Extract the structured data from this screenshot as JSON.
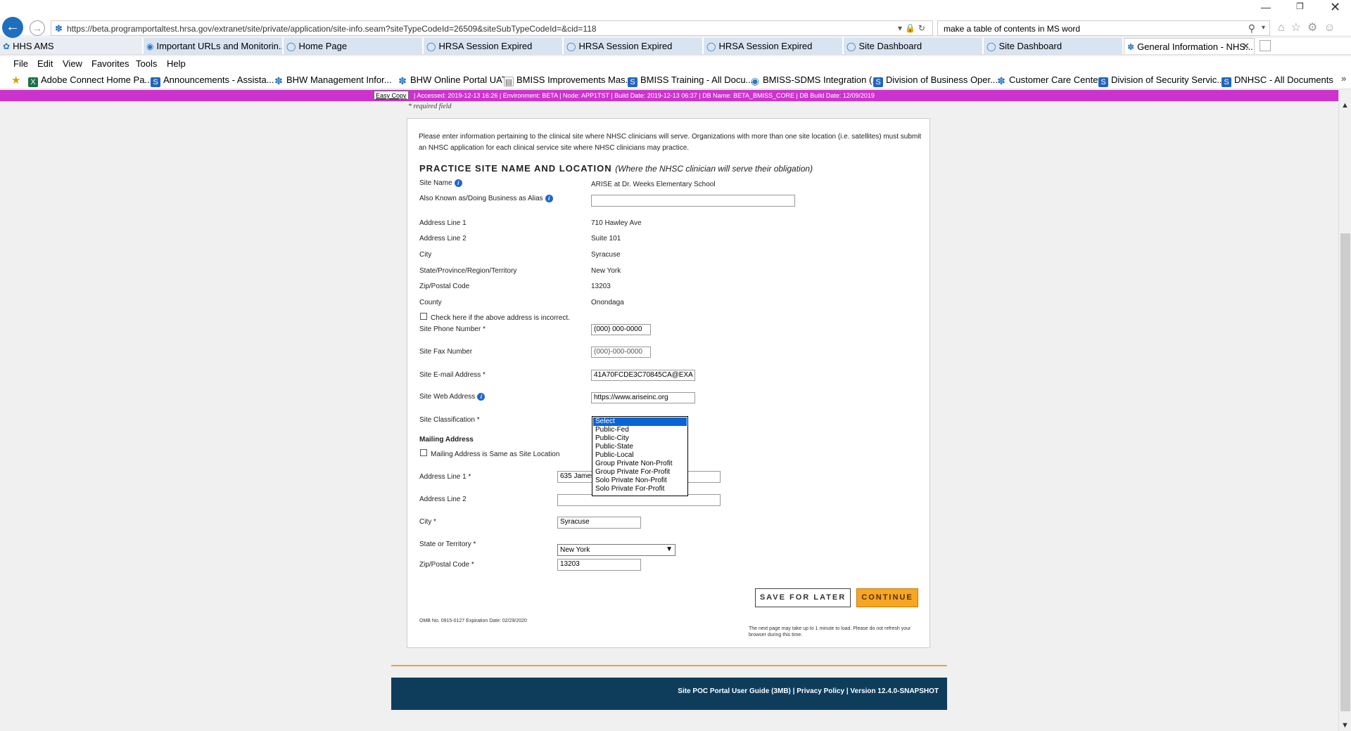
{
  "browser": {
    "url": "https://beta.programportaltest.hrsa.gov/extranet/site/private/application/site-info.seam?siteTypeCodeId=26509&siteSubTypeCodeId=&cid=118",
    "search": "make a table of contents in MS word",
    "tabs": [
      {
        "label": "HHS AMS"
      },
      {
        "label": "Important URLs and Monitorin..."
      },
      {
        "label": "Home Page"
      },
      {
        "label": "HRSA Session Expired"
      },
      {
        "label": "HRSA Session Expired"
      },
      {
        "label": "HRSA Session Expired"
      },
      {
        "label": "Site Dashboard"
      },
      {
        "label": "Site Dashboard"
      },
      {
        "label": "General Information - NHS..."
      }
    ],
    "menu": [
      "File",
      "Edit",
      "View",
      "Favorites",
      "Tools",
      "Help"
    ],
    "favorites": [
      "Adobe Connect Home Pa...",
      "Announcements - Assista...",
      "BHW Management Infor...",
      "BHW Online Portal UAT",
      "BMISS Improvements Mas...",
      "BMISS Training - All Docu...",
      "BMISS-SDMS Integration (...",
      "Division of Business Oper...",
      "Customer Care Center",
      "Division of Security Servic...",
      "DNHSC - All Documents"
    ]
  },
  "env_bar": {
    "easy_copy": "Easy Copy",
    "text": "|   Accessed: 2019-12-13 16:26   |   Environment: BETA   |   Node: APP1TST   |   Build Date: 2019-12-13 06:37   |   DB Name: BETA_BMISS_CORE   |   DB Build Date: 12/09/2019"
  },
  "form": {
    "required_note": "* required field",
    "intro": "Please enter information pertaining to the clinical site where NHSC clinicians will serve. Organizations with more than one site location (i.e. satellites) must submit an NHSC application for each clinical service site where NHSC clinicians may practice.",
    "section_title": "PRACTICE SITE NAME AND LOCATION",
    "section_subtitle": "(Where the NHSC clinician will serve their obligation)",
    "site_name_label": "Site Name",
    "site_name": "ARISE at Dr. Weeks Elementary School",
    "alias_label": "Also Known as/Doing Business as Alias",
    "alias_value": "",
    "address1_label": "Address Line 1",
    "address1": "710 Hawley Ave",
    "address2_label": "Address Line 2",
    "address2": "Suite 101",
    "city_label": "City",
    "city": "Syracuse",
    "state_label": "State/Province/Region/Territory",
    "state": "New York",
    "zip_label": "Zip/Postal Code",
    "zip": "13203",
    "county_label": "County",
    "county": "Onondaga",
    "incorrect_label": "Check here if the above address is incorrect.",
    "phone_label": "Site Phone Number *",
    "phone": "(000) 000-0000",
    "fax_label": "Site Fax Number",
    "fax_placeholder": "(000)-000-0000",
    "email_label": "Site E-mail Address *",
    "email": "41A70FCDE3C70845CA@EXA",
    "web_label": "Site Web Address",
    "web": "https://www.ariseinc.org",
    "classification_label": "Site Classification *",
    "classification_options": [
      "Select",
      "Public-Fed",
      "Public-City",
      "Public-State",
      "Public-Local",
      "Group Private Non-Profit",
      "Group Private For-Profit",
      "Solo Private Non-Profit",
      "Solo Private For-Profit"
    ],
    "mailing_heading": "Mailing Address",
    "mailing_same_label": "Mailing Address is Same as Site Location",
    "m_address1_label": "Address Line 1 *",
    "m_address1": "635 James",
    "m_address2_label": "Address Line 2",
    "m_address2": "",
    "m_city_label": "City *",
    "m_city": "Syracuse",
    "m_state_label": "State or Territory *",
    "m_state": "New York",
    "m_zip_label": "Zip/Postal Code *",
    "m_zip": "13203",
    "save_label": "SAVE FOR LATER",
    "continue_label": "CONTINUE",
    "omb": "OMB No. 0915-0127 Expiration Date: 02/29/2020",
    "load_note": "The next page may take up to 1 minute to load. Please do not refresh your browser during this time."
  },
  "footer": {
    "text": "Site POC Portal User Guide (3MB) | Privacy Policy | Version 12.4.0-SNAPSHOT"
  },
  "colors": {
    "env_bar": "#cc33cc",
    "footer": "#0e3d5c",
    "continue": "#f5a623",
    "selected_option": "#0a64d6"
  }
}
